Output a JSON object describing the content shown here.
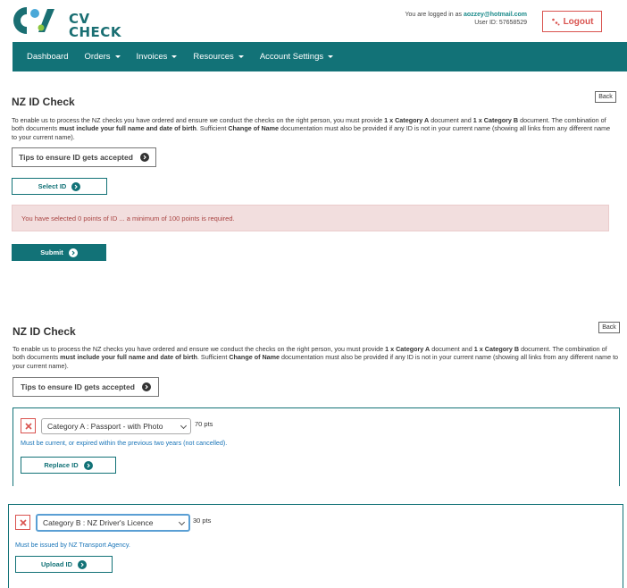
{
  "brand": {
    "line1": "CV",
    "line2": "CHECK"
  },
  "header": {
    "logged_in_prefix": "You are logged in as",
    "email": "aozzey@hotmail.com",
    "user_id": "User ID: 57658529",
    "logout_label": "Logout"
  },
  "nav": {
    "items": [
      {
        "label": "Dashboard",
        "has_menu": false
      },
      {
        "label": "Orders",
        "has_menu": true
      },
      {
        "label": "Invoices",
        "has_menu": true
      },
      {
        "label": "Resources",
        "has_menu": true
      },
      {
        "label": "Account Settings",
        "has_menu": true
      }
    ]
  },
  "page": {
    "title": "NZ ID Check",
    "back_label": "Back",
    "intro": {
      "p1": "To enable us to process the NZ checks you have ordered and ensure we conduct the checks on the right person, you must provide ",
      "b1": "1 x Category A",
      "p2": " document and ",
      "b2": "1 x Category B",
      "p3": " document. The combination of both documents ",
      "b3": "must include your full name and date of birth",
      "p4": ". Sufficient ",
      "b4": "Change of Name",
      "p5": " documentation must also be provided if any ID is not in your current name (showing all links from any different name to your current name)."
    },
    "tips_label": "Tips to ensure ID gets accepted"
  },
  "step1": {
    "select_id_label": "Select ID",
    "alert_text": "You have selected 0 points of ID ... a minimum of 100 points is required.",
    "submit_label": "Submit"
  },
  "step2": {
    "category_a": {
      "selected": "Category A : Passport - with Photo",
      "points": "70 pts",
      "hint": "Must be current, or expired within the previous two years (not cancelled).",
      "action_label": "Replace ID"
    },
    "category_b": {
      "selected": "Category B : NZ Driver's Licence",
      "points": "30 pts",
      "hint": "Must be issued by NZ Transport Agency.",
      "action_label": "Upload ID"
    }
  },
  "colors": {
    "brand_teal": "#127277",
    "danger_red": "#d9534f",
    "alert_bg": "#f2dede",
    "link_blue": "#1a75b8"
  },
  "icons": {
    "logo": "cv-check-logo",
    "logout": "logout-icon",
    "arrow": "circle-arrow-right-icon",
    "remove": "close-x-icon",
    "dropdown": "chevron-down-icon"
  }
}
